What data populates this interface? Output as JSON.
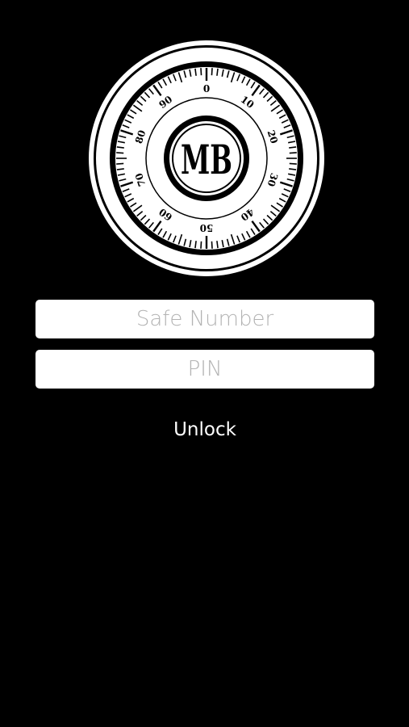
{
  "logo": {
    "monogram": "MB",
    "dial_numbers": [
      "0",
      "10",
      "20",
      "30",
      "40",
      "50",
      "60",
      "70",
      "80",
      "90"
    ]
  },
  "form": {
    "safe_number_placeholder": "Safe Number",
    "safe_number_value": "",
    "pin_placeholder": "PIN",
    "pin_value": "",
    "unlock_label": "Unlock"
  },
  "colors": {
    "background": "#000000",
    "field_background": "#ffffff",
    "placeholder": "#b3b3b3",
    "button_text": "#ffffff"
  },
  "icons": {
    "logo": "combination-dial-logo"
  }
}
